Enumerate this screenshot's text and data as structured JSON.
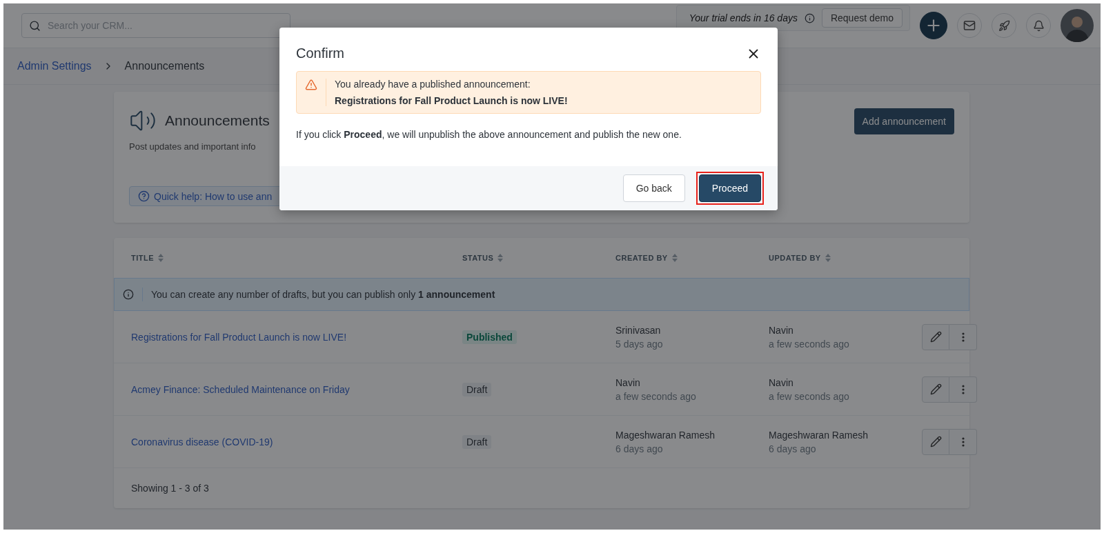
{
  "topbar": {
    "search": {
      "placeholder": "Search your CRM..."
    },
    "trial": "Your trial ends in 16 days",
    "request_demo": "Request demo"
  },
  "breadcrumb": [
    {
      "label": "Admin Settings",
      "link": true
    },
    {
      "label": "Announcements",
      "link": false
    }
  ],
  "header_card": {
    "title": "Announcements",
    "description": "Post updates and important info",
    "help_link": "Quick help: How to use ann",
    "add_button": "Add announcement"
  },
  "table": {
    "columns": [
      "TITLE",
      "STATUS",
      "CREATED BY",
      "UPDATED BY"
    ],
    "notice": "You can create any number of drafts, but you can publish only **1 announcement**",
    "rows": [
      {
        "title": "Registrations for Fall Product Launch is now LIVE!",
        "status": {
          "label": "Published",
          "kind": "published"
        },
        "created_by": "Srinivasan",
        "created_at": "5 days ago",
        "updated_by": "Navin",
        "updated_at": "a few seconds ago"
      },
      {
        "title": "Acmey Finance: Scheduled Maintenance on Friday",
        "status": {
          "label": "Draft",
          "kind": "draft"
        },
        "created_by": "Navin",
        "created_at": "a few seconds ago",
        "updated_by": "Navin",
        "updated_at": "a few seconds ago"
      },
      {
        "title": "Coronavirus disease (COVID-19)",
        "status": {
          "label": "Draft",
          "kind": "draft"
        },
        "created_by": "Mageshwaran Ramesh",
        "created_at": "6 days ago",
        "updated_by": "Mageshwaran Ramesh",
        "updated_at": "6 days ago"
      }
    ],
    "footer": "Showing 1 - 3 of 3"
  },
  "dialog": {
    "title": "Confirm",
    "alert_line": "You already have a published announcement:",
    "alert_title": "Registrations for Fall Product Launch is now LIVE!",
    "message": "If you click **Proceed**, we will unpublish the above announcement and publish the new one.",
    "buttons": [
      {
        "label": "Go back",
        "kind": "secondary",
        "highlighted": false
      },
      {
        "label": "Proceed",
        "kind": "primary",
        "highlighted": true
      }
    ]
  }
}
